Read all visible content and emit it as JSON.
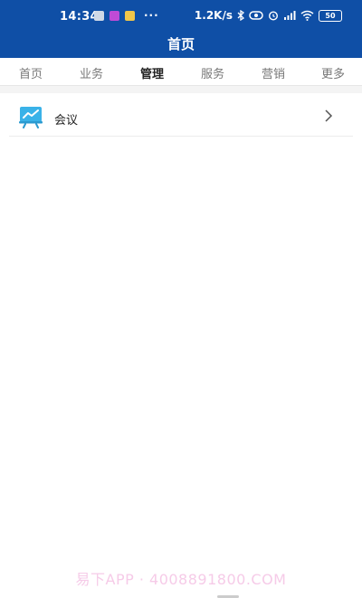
{
  "status_bar": {
    "time": "14:34",
    "dots": "···",
    "network_speed": "1.2K/s",
    "battery": "50"
  },
  "header": {
    "title": "首页"
  },
  "tabs": [
    {
      "label": "首页",
      "active": false
    },
    {
      "label": "业务",
      "active": false
    },
    {
      "label": "管理",
      "active": true
    },
    {
      "label": "服务",
      "active": false
    },
    {
      "label": "营销",
      "active": false
    },
    {
      "label": "更多",
      "active": false
    }
  ],
  "list": {
    "items": [
      {
        "label": "会议",
        "icon": "presentation-chart-icon"
      }
    ]
  },
  "watermark": "易下APP · 4008891800.COM",
  "colors": {
    "header_bg": "#0f4fa6",
    "active_tab_underline": "#1b4fa0",
    "icon_accent": "#3ab2e8"
  }
}
